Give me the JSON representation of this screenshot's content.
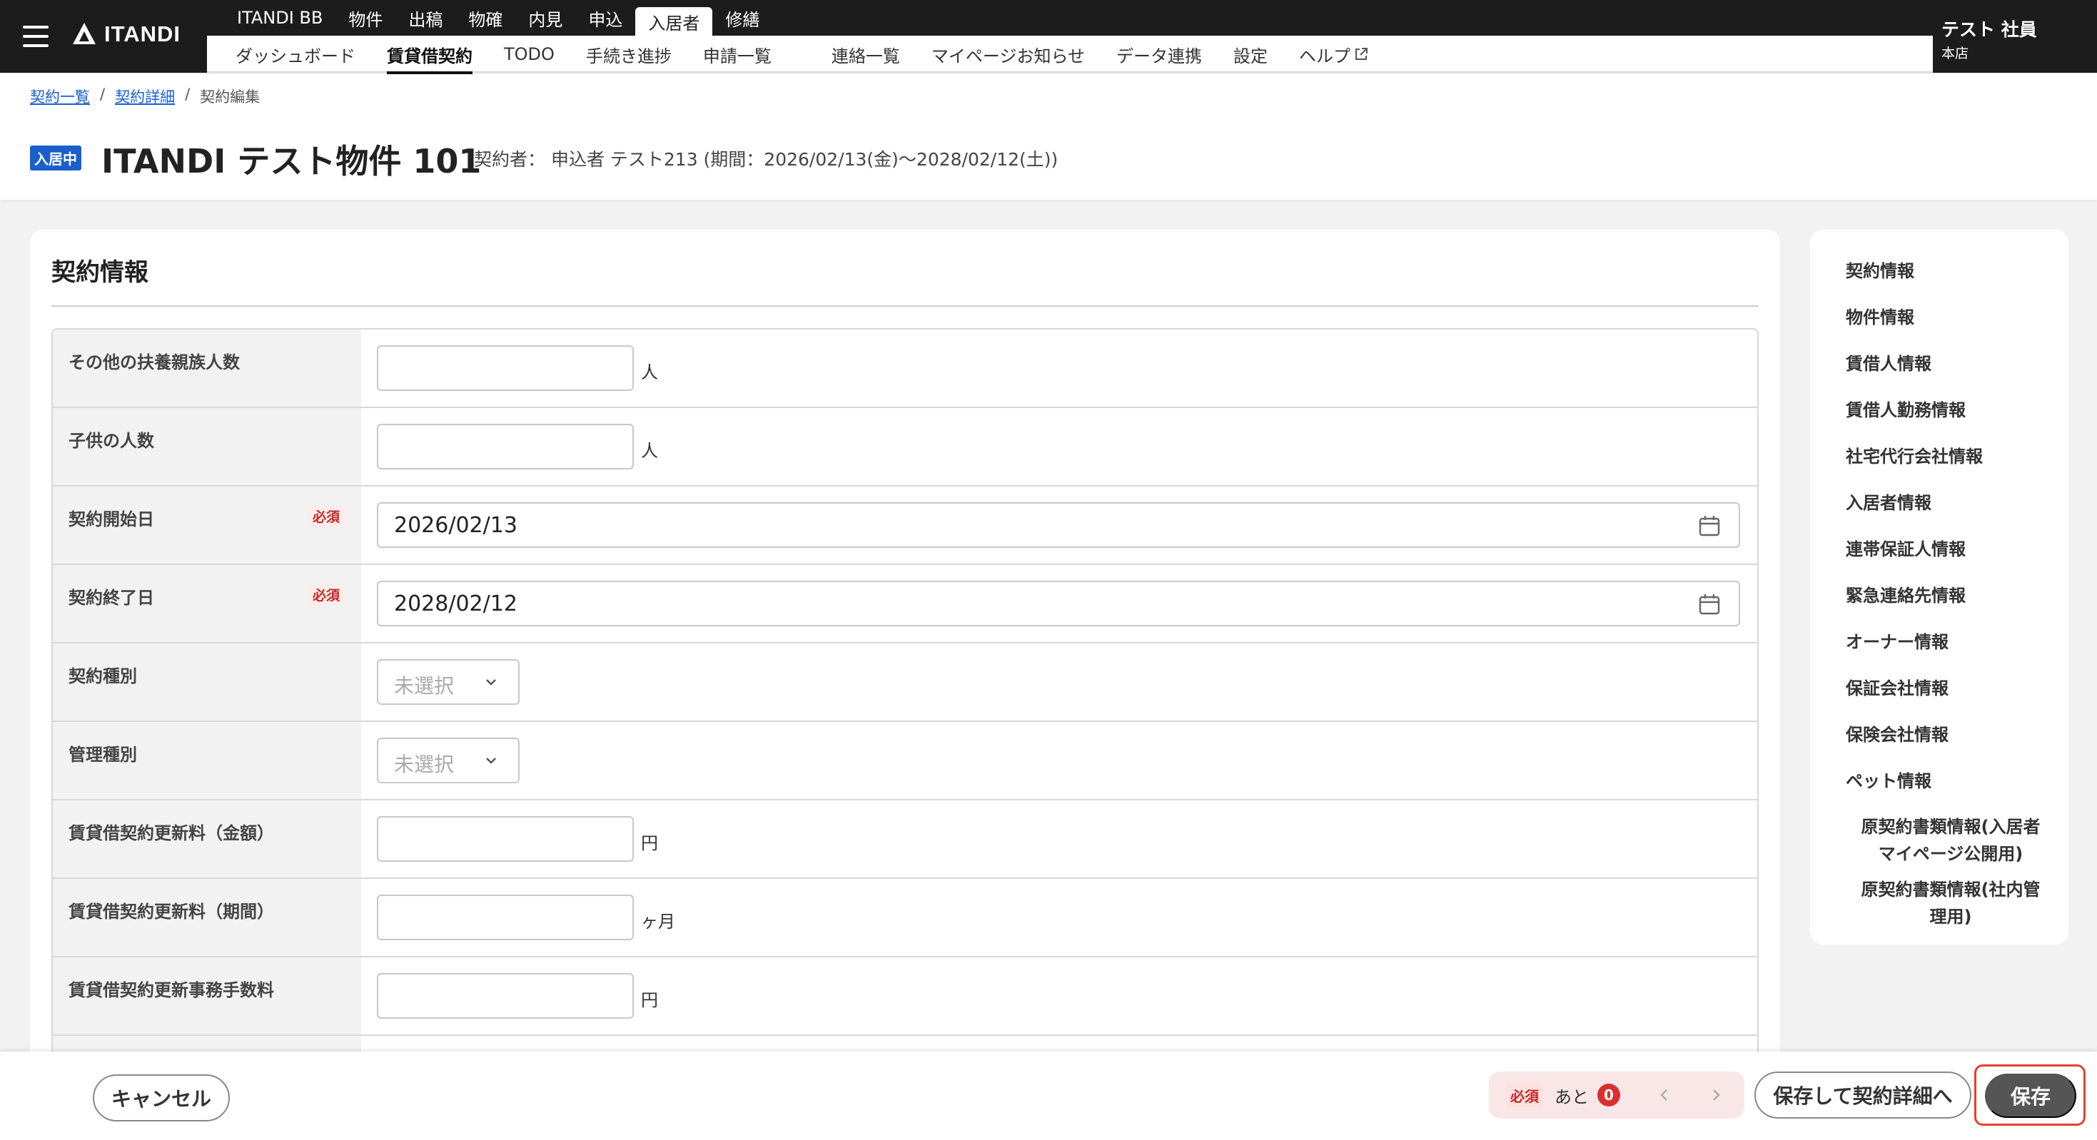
{
  "header": {
    "logo_text": "ITANDI",
    "services": [
      "ITANDI BB",
      "物件",
      "出稿",
      "物確",
      "内見",
      "申込",
      "入居者",
      "修繕"
    ],
    "active_service": "入居者",
    "subnav": [
      "ダッシュボード",
      "賃貸借契約",
      "TODO",
      "手続き進捗",
      "申請一覧",
      "連絡一覧",
      "マイページお知らせ",
      "データ連携",
      "設定",
      "ヘルプ"
    ],
    "active_subnav": "賃貸借契約",
    "user_name": "テスト 社員",
    "user_branch": "本店"
  },
  "breadcrumb": {
    "item1": "契約一覧",
    "sep1": "/",
    "item2": "契約詳細",
    "sep2": "/",
    "current": "契約編集"
  },
  "page": {
    "status_badge": "入居中",
    "title": "ITANDI テスト物件 101",
    "meta": "契約者： 申込者 テスト213 (期間：2026/02/13(金)〜2028/02/12(土))"
  },
  "section": {
    "title": "契約情報",
    "required_label": "必須",
    "rows": [
      {
        "label": "その他の扶養親族人数",
        "value": "",
        "unit": "人"
      },
      {
        "label": "子供の人数",
        "value": "",
        "unit": "人"
      },
      {
        "label": "契約開始日",
        "value": "2026/02/13"
      },
      {
        "label": "契約終了日",
        "value": "2028/02/12"
      },
      {
        "label": "契約種別",
        "value": "未選択"
      },
      {
        "label": "管理種別",
        "value": "未選択"
      },
      {
        "label": "賃貸借契約更新料（金額）",
        "value": "",
        "unit": "円"
      },
      {
        "label": "賃貸借契約更新料（期間）",
        "value": "",
        "unit": "ヶ月"
      },
      {
        "label": "賃貸借契約更新事務手数料",
        "value": "",
        "unit": "円"
      }
    ]
  },
  "sidenav": {
    "items": [
      "契約情報",
      "物件情報",
      "賃借人情報",
      "賃借人勤務情報",
      "社宅代行会社情報",
      "入居者情報",
      "連帯保証人情報",
      "緊急連絡先情報",
      "オーナー情報",
      "保証会社情報",
      "保険会社情報",
      "ペット情報",
      "原契約書類情報(入居者マイページ公開用)",
      "原契約書類情報(社内管理用)"
    ]
  },
  "footer": {
    "cancel_label": "キャンセル",
    "required_tag": "必須",
    "remaining_label": "あと",
    "remaining_count": "0",
    "save_detail_label": "保存して契約詳細へ",
    "save_label": "保存"
  },
  "colors": {
    "header_bg": "#1c1c1c",
    "accent_blue": "#1a5fcb",
    "required_red": "#c62828",
    "save_outline": "#e0422f"
  }
}
